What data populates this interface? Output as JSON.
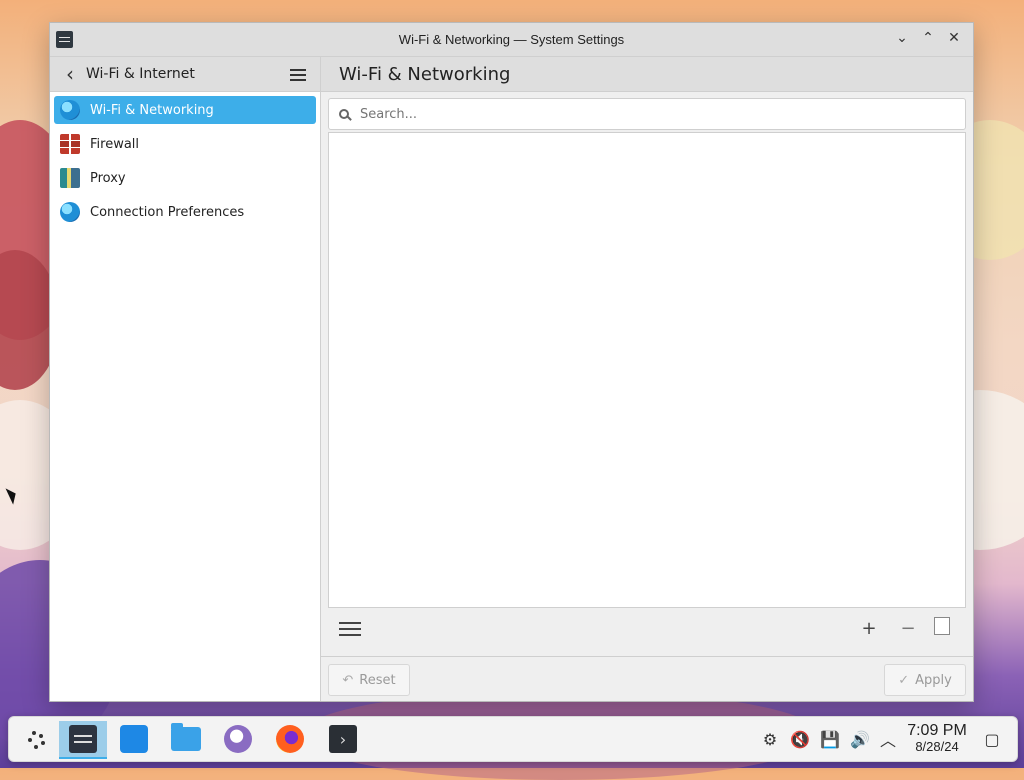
{
  "window": {
    "title": "Wi-Fi & Networking — System Settings"
  },
  "sidebar": {
    "title": "Wi-Fi & Internet",
    "items": [
      {
        "label": "Wi-Fi & Networking",
        "icon": "globe-icon",
        "active": true
      },
      {
        "label": "Firewall",
        "icon": "firewall-icon",
        "active": false
      },
      {
        "label": "Proxy",
        "icon": "proxy-icon",
        "active": false
      },
      {
        "label": "Connection Preferences",
        "icon": "globe-icon",
        "active": false
      }
    ]
  },
  "main": {
    "title": "Wi-Fi & Networking",
    "search": {
      "placeholder": "Search..."
    }
  },
  "footer": {
    "reset_label": "Reset",
    "apply_label": "Apply"
  },
  "taskbar": {
    "clock": {
      "time": "7:09 PM",
      "date": "8/28/24"
    }
  },
  "colors": {
    "accent": "#3daee9"
  }
}
